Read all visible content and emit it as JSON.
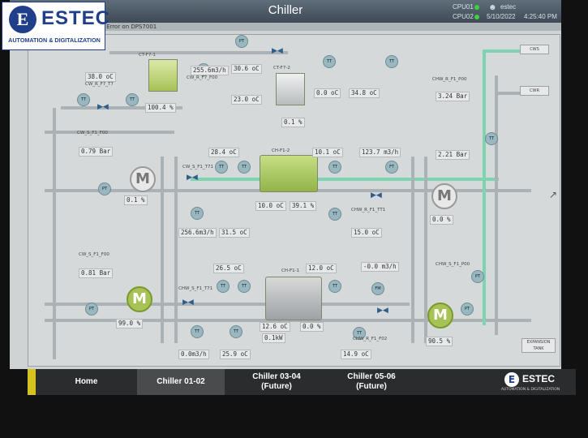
{
  "header": {
    "title": "Chiller",
    "cpu1": "CPU01",
    "cpu2": "CPU02",
    "user": "estec",
    "date": "5/10/2022",
    "time": "4:25:40 PM",
    "alarm": "01 Error on DPS7001"
  },
  "logo": {
    "word": "ESTEC",
    "subtitle": "AUTOMATION & DIGITALIZATION"
  },
  "towers": [
    {
      "name": "CT-F7-1",
      "value": "100.4 %",
      "state": "on"
    },
    {
      "name": "CT-F7-2",
      "value": "0.1 %",
      "state": "off"
    }
  ],
  "chillers": [
    {
      "name": "CH-F1-1",
      "value": "0.1kW",
      "state": "off"
    },
    {
      "name": "CH-F1-2",
      "value": "10.0 oC",
      "state": "on"
    }
  ],
  "values": [
    {
      "id": "v1",
      "text": "38.0 oC"
    },
    {
      "id": "v2",
      "text": "255.6m3/h"
    },
    {
      "id": "v3",
      "text": "30.6 oC"
    },
    {
      "id": "v4",
      "text": "23.0 oC"
    },
    {
      "id": "v5",
      "text": "0.79 Bar"
    },
    {
      "id": "v6",
      "text": "28.4 oC"
    },
    {
      "id": "v7",
      "text": "10.1 oC"
    },
    {
      "id": "v8",
      "text": "123.7 m3/h"
    },
    {
      "id": "v9",
      "text": "3.24 Bar"
    },
    {
      "id": "v10",
      "text": "2.21 Bar"
    },
    {
      "id": "v11",
      "text": "10.0 oC"
    },
    {
      "id": "v12",
      "text": "39.1 %"
    },
    {
      "id": "v13",
      "text": "256.6m3/h"
    },
    {
      "id": "v14",
      "text": "31.5 oC"
    },
    {
      "id": "v15",
      "text": "15.0 oC"
    },
    {
      "id": "v16",
      "text": "26.5 oC"
    },
    {
      "id": "v17",
      "text": "12.0 oC"
    },
    {
      "id": "v18",
      "text": "-0.0 m3/h"
    },
    {
      "id": "v19",
      "text": "0.81 Bar"
    },
    {
      "id": "v20",
      "text": "12.6 oC"
    },
    {
      "id": "v21",
      "text": "0.0 %"
    },
    {
      "id": "v22",
      "text": "0.0 oC"
    },
    {
      "id": "v23",
      "text": "34.8 oC"
    },
    {
      "id": "v24",
      "text": "99.0 %"
    },
    {
      "id": "v25",
      "text": "0.0m3/h"
    },
    {
      "id": "v26",
      "text": "25.9 oC"
    },
    {
      "id": "v27",
      "text": "14.9 oC"
    },
    {
      "id": "v28",
      "text": "90.5 %"
    },
    {
      "id": "v29",
      "text": "0.1 %"
    },
    {
      "id": "v30",
      "text": "0.0 %"
    }
  ],
  "tags": [
    "CW_R_F7_T7",
    "CW_R_F7_F00",
    "CW_S_F1_F00",
    "CW_S_F1_T71",
    "CHW_S_F1_T71",
    "CHW_R_F1_TT1",
    "CW_S_F1_F00",
    "CHW_R_F1_P00",
    "CHW_S_F1_P00",
    "CHW_R_F1_F02",
    "EXPANSION TANK",
    "CWS",
    "CWR"
  ],
  "outtags": [
    "CWS",
    "CWR"
  ],
  "nav": [
    {
      "label": "Home",
      "sel": false
    },
    {
      "label": "Chiller 01-02",
      "sel": true
    },
    {
      "label": "Chiller 03-04\n(Future)",
      "sel": false
    },
    {
      "label": "Chiller 05-06\n(Future)",
      "sel": false
    }
  ],
  "colors": {
    "accent": "#1f3f8a",
    "running": "#a7c256",
    "pipe": "#aab2b5",
    "chw_pipe": "#7ed3b0"
  }
}
